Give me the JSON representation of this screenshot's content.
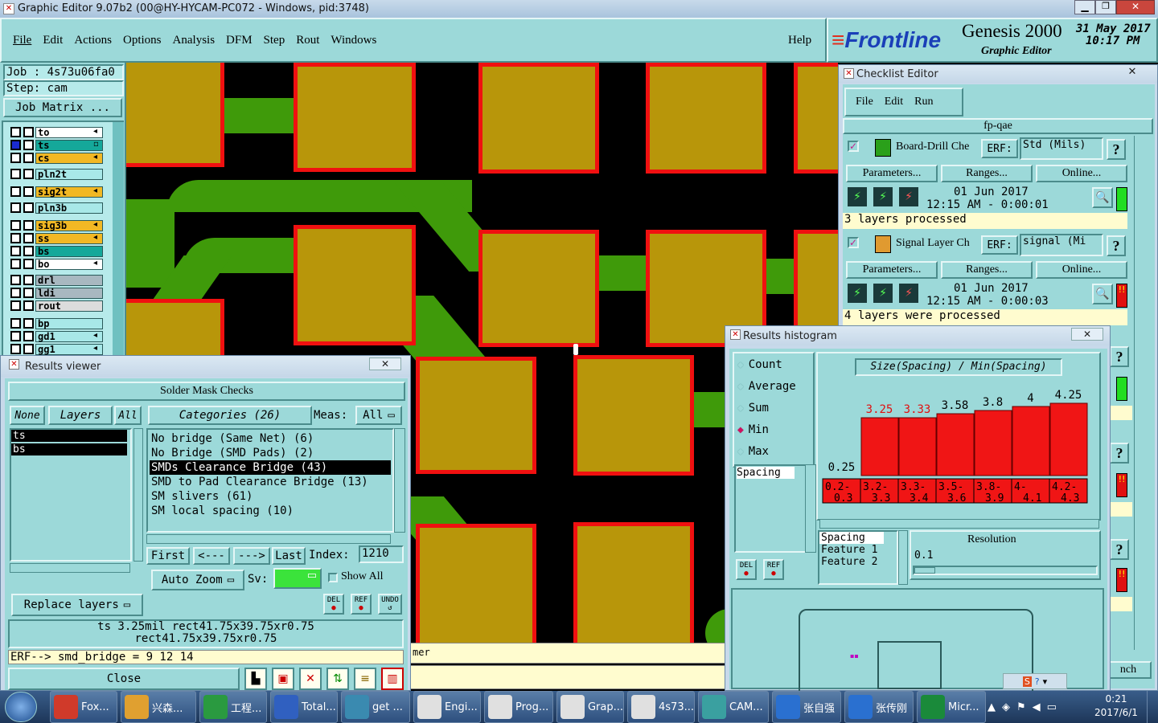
{
  "window": {
    "title": "Graphic Editor 9.07b2 (00@HY-HYCAM-PC072 - Windows, pid:3748)"
  },
  "menu": {
    "items": [
      "File",
      "Edit",
      "Actions",
      "Options",
      "Analysis",
      "DFM",
      "Step",
      "Rout",
      "Windows"
    ],
    "help": "Help"
  },
  "brand": {
    "logo": "Frontline",
    "product": "Genesis 2000",
    "subtitle": "Graphic Editor",
    "date": "31 May 2017",
    "time": "10:17 PM"
  },
  "job": {
    "job": "Job : 4s73u06fa0",
    "step": "Step: cam",
    "matrix": "Job Matrix ..."
  },
  "layers": [
    {
      "name": "to",
      "color": "#ffffff",
      "ind": "◂"
    },
    {
      "name": "ts",
      "color": "#15a89a",
      "ind": "▫"
    },
    {
      "name": "cs",
      "color": "#f2b824",
      "ind": "◂"
    },
    {
      "name": "pln2t",
      "color": "#a8e8e8",
      "ind": ""
    },
    {
      "name": "sig2t",
      "color": "#f2b824",
      "ind": "◂"
    },
    {
      "name": "pln3b",
      "color": "#a8e8e8",
      "ind": ""
    },
    {
      "name": "sig3b",
      "color": "#f2b824",
      "ind": "◂"
    },
    {
      "name": "ss",
      "color": "#f2b824",
      "ind": "◂"
    },
    {
      "name": "bs",
      "color": "#15a89a",
      "ind": ""
    },
    {
      "name": "bo",
      "color": "#ffffff",
      "ind": "◂"
    },
    {
      "name": "drl",
      "color": "#a8b8c0",
      "ind": ""
    },
    {
      "name": "ldi",
      "color": "#a8b8c0",
      "ind": ""
    },
    {
      "name": "rout",
      "color": "#dcdcdc",
      "ind": ""
    },
    {
      "name": "bp",
      "color": "#a8e8e8",
      "ind": ""
    },
    {
      "name": "gd1",
      "color": "#a8e8e8",
      "ind": "◂"
    },
    {
      "name": "gg1",
      "color": "#a8e8e8",
      "ind": "◂"
    }
  ],
  "results_viewer": {
    "title": "Results viewer",
    "header": "Solder Mask Checks",
    "none": "None",
    "layers": "Layers",
    "all": "All",
    "categories": "Categories (26)",
    "meas": "Meas:",
    "meas_val": "All",
    "layer_list": [
      "ts",
      "bs"
    ],
    "category_list": [
      "No bridge (Same Net) (6)",
      "No Bridge (SMD Pads) (2)",
      "SMDs Clearance Bridge (43)",
      "SMD to Pad Clearance Bridge (13)",
      "SM slivers (61)",
      "SM local spacing (10)"
    ],
    "first": "First",
    "prev": "<---",
    "next": "--->",
    "last": "Last",
    "index_label": "Index:",
    "index_val": "1210",
    "auto_zoom": "Auto Zoom",
    "sv": "Sv:",
    "show_all": "Show All",
    "replace": "Replace layers",
    "del": "DEL",
    "ref": "REF",
    "undo": "UNDO",
    "meas_line1": "ts 3.25mil  rect41.75x39.75xr0.75",
    "meas_line2": "rect41.75x39.75xr0.75",
    "erf": "ERF--> smd_bridge = 9 12 14",
    "close": "Close"
  },
  "checklist": {
    "title": "Checklist Editor",
    "menu": [
      "File",
      "Edit",
      "Run"
    ],
    "name": "fp-qae",
    "checks": [
      {
        "name": "Board-Drill Che",
        "erf": "ERF:",
        "std": "Std (Mils)",
        "params": "Parameters...",
        "ranges": "Ranges...",
        "online": "Online...",
        "date": "01 Jun 2017",
        "time": "12:15 AM - 0:00:01",
        "status": "3 layers processed"
      },
      {
        "name": "Signal Layer Ch",
        "erf": "ERF:",
        "std": "signal (Mi",
        "params": "Parameters...",
        "ranges": "Ranges...",
        "online": "Online...",
        "date": "01 Jun 2017",
        "time": "12:15 AM - 0:00:03",
        "status": "4 layers were processed"
      }
    ],
    "q": "?",
    "bottom_frag": "nch"
  },
  "histogram": {
    "title": "Results histogram",
    "options": [
      "Count",
      "Average",
      "Sum",
      "Min",
      "Max"
    ],
    "selected": "Min",
    "chart_title": "Size(Spacing) / Min(Spacing)",
    "list_item": "Spacing",
    "sel_list": [
      "Spacing",
      "Feature 1",
      "Feature 2"
    ],
    "resolution": "Resolution",
    "res_val": "0.1",
    "del": "DEL",
    "ref": "REF"
  },
  "chart_data": {
    "type": "bar",
    "title": "Size(Spacing) / Min(Spacing)",
    "categories": [
      "0.2-0.3",
      "3.2-3.3",
      "3.3-3.4",
      "3.5-3.6",
      "3.8-3.9",
      "4-4.1",
      "4.2-4.3"
    ],
    "values": [
      0.25,
      3.25,
      3.33,
      3.58,
      3.8,
      4,
      4.25
    ],
    "labels": [
      "0.25",
      "3.25",
      "3.33",
      "3.58",
      "3.8",
      "4",
      "4.25"
    ],
    "heights": [
      0,
      0.65,
      0.65,
      0.7,
      0.74,
      0.78,
      0.82
    ],
    "xlabel": "",
    "ylabel": ""
  },
  "status_frag": "mer",
  "taskbar": {
    "items": [
      "Fox...",
      "兴森...",
      "工程...",
      "Total...",
      "get ...",
      "Engi...",
      "Prog...",
      "Grap...",
      "4s73...",
      "CAM...",
      "张自强",
      "张传刚",
      "Micr..."
    ],
    "time": "0:21",
    "date": "2017/6/1"
  }
}
